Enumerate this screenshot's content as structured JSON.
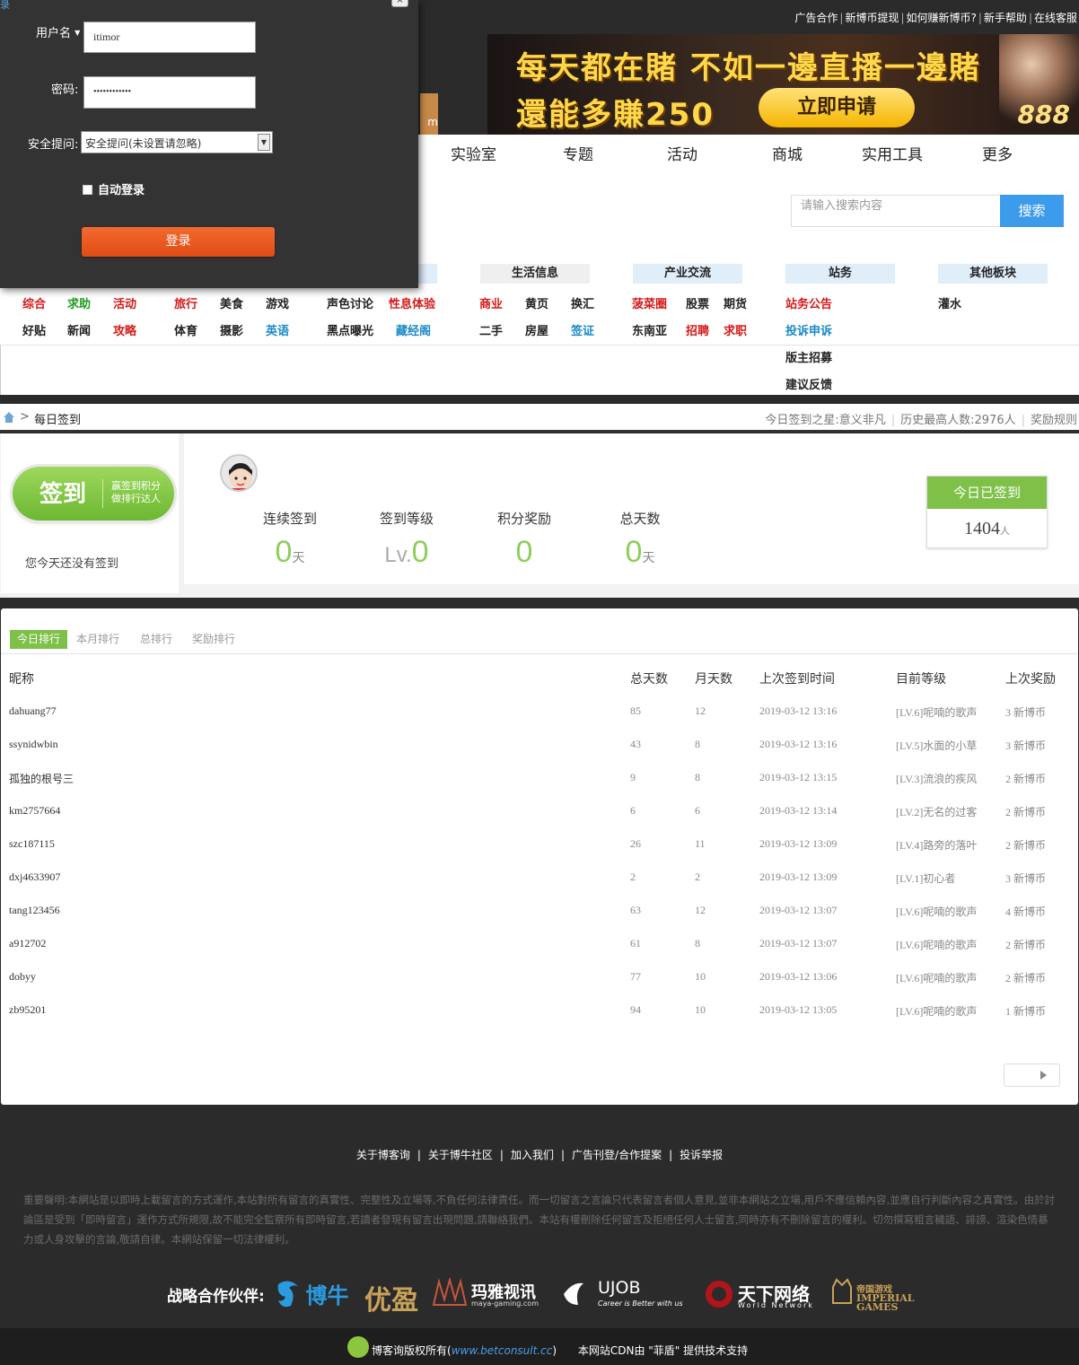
{
  "topbar": {
    "links": [
      "广告合作",
      "新博币提现",
      "如何赚新博币?",
      "新手帮助",
      "在线客服"
    ]
  },
  "banner": {
    "line1": "每天都在賭 不如一邊直播一邊賭",
    "line2": "還能多賺250",
    "button": "立即申请",
    "badge": "888"
  },
  "orange_fragment": "m",
  "nav": [
    "实验室",
    "专题",
    "活动",
    "商城",
    "实用工具",
    "更多"
  ],
  "search": {
    "placeholder": "请输入搜索内容",
    "button": "搜索"
  },
  "categories": {
    "headers": [
      "生活信息",
      "产业交流",
      "站务",
      "其他板块"
    ],
    "items": {
      "c1": [
        "综合",
        "求助",
        "活动",
        "旅行",
        "美食",
        "游戏",
        "声色讨论",
        "性息体验"
      ],
      "c2": [
        "好贴",
        "新闻",
        "攻略",
        "体育",
        "摄影",
        "英语",
        "黑点曝光",
        "藏经阁"
      ],
      "life1": [
        "商业",
        "黄页",
        "换汇"
      ],
      "life2": [
        "二手",
        "房屋",
        "签证"
      ],
      "ind1": [
        "菠菜圈",
        "股票",
        "期货"
      ],
      "ind2": [
        "东南亚",
        "招聘",
        "求职"
      ],
      "site": [
        "站务公告",
        "投诉申诉",
        "版主招募",
        "建议反馈"
      ],
      "other": [
        "灌水"
      ]
    }
  },
  "breadcrumb": {
    "separator": ">",
    "title": "每日签到",
    "star": "今日签到之星:意义非凡",
    "record": "历史最高人数:2976人",
    "rules": "奖励规则"
  },
  "sign": {
    "button": "签到",
    "slogan1": "赢签到积分",
    "slogan2": "做排行达人",
    "note": "您今天还没有签到",
    "stats": [
      {
        "label": "连续签到",
        "value": "0",
        "unit": "天"
      },
      {
        "label": "签到等级",
        "prefix": "Lv.",
        "value": "0"
      },
      {
        "label": "积分奖励",
        "value": "0"
      },
      {
        "label": "总天数",
        "value": "0",
        "unit": "天"
      }
    ],
    "today_label": "今日已签到",
    "today_count": "1404",
    "today_unit": "人"
  },
  "ranking": {
    "tabs": [
      "今日排行",
      "本月排行",
      "总排行",
      "奖励排行"
    ],
    "columns": [
      "昵称",
      "总天数",
      "月天数",
      "上次签到时间",
      "目前等级",
      "上次奖励"
    ],
    "rows": [
      [
        "dahuang77",
        "85",
        "12",
        "2019-03-12 13:16",
        "[LV.6]呢喃的歌声",
        "3 新博币"
      ],
      [
        "ssynidwbin",
        "43",
        "8",
        "2019-03-12 13:16",
        "[LV.5]水面的小草",
        "3 新博币"
      ],
      [
        "孤独的根号三",
        "9",
        "8",
        "2019-03-12 13:15",
        "[LV.3]流浪的疾风",
        "2 新博币"
      ],
      [
        "km2757664",
        "6",
        "6",
        "2019-03-12 13:14",
        "[LV.2]无名的过客",
        "2 新博币"
      ],
      [
        "szc187115",
        "26",
        "11",
        "2019-03-12 13:09",
        "[LV.4]路旁的落叶",
        "2 新博币"
      ],
      [
        "dxj4633907",
        "2",
        "2",
        "2019-03-12 13:09",
        "[LV.1]初心者",
        "3 新博币"
      ],
      [
        "tang123456",
        "63",
        "12",
        "2019-03-12 13:07",
        "[LV.6]呢喃的歌声",
        "4 新博币"
      ],
      [
        "a912702",
        "61",
        "8",
        "2019-03-12 13:07",
        "[LV.6]呢喃的歌声",
        "2 新博币"
      ],
      [
        "dobyy",
        "77",
        "10",
        "2019-03-12 13:06",
        "[LV.6]呢喃的歌声",
        "2 新博币"
      ],
      [
        "zb95201",
        "94",
        "10",
        "2019-03-12 13:05",
        "[LV.6]呢喃的歌声",
        "1 新博币"
      ]
    ]
  },
  "footer": {
    "links": [
      "关于博客询",
      "关于博牛社区",
      "加入我们",
      "广告刊登/合作提案",
      "投诉举报"
    ],
    "disclaimer": "重要聲明:本網站是以即時上載留言的方式運作,本站對所有留言的真實性、完整性及立場等,不負任何法律責任。而一切留言之言論只代表留言者個人意見,並非本網站之立場,用戶不應信賴內容,並應自行判斷內容之真實性。由於討論區是受到「即時留言」運作方式所規限,故不能完全監察所有即時留言,若讀者發現有留言出現問題,請聯絡我們。本站有權刪除任何留言及拒絕任何人士留言,同時亦有不刪除留言的權利。切勿撰寫粗言穢語、誹謗、渲染色情暴力或人身攻擊的言論,敬請自律。本網站保留一切法律權利。",
    "partners_label": "战略合作伙伴:",
    "partners": [
      "博牛",
      "优盈",
      "玛雅视讯",
      "maya-gaming.com",
      "UJOB",
      "Career is Better with us",
      "天下网络",
      "World Network",
      "帝国游戏",
      "IMPERIAL GAMES"
    ],
    "copyright_pre": "博客询版权所有(",
    "copyright_url": "www.betconsult.cc",
    "copyright_post": ")",
    "cdn": "本网站CDN由 \"菲盾\" 提供技术支持"
  },
  "login": {
    "fragment": "录",
    "close": "×",
    "username_label": "用户名",
    "username_value": "itimor",
    "password_label": "密码:",
    "password_value": "••••••••••••",
    "question_label": "安全提问:",
    "question_value": "安全提问(未设置请忽略)",
    "auto_login": "自动登录",
    "submit": "登录"
  }
}
